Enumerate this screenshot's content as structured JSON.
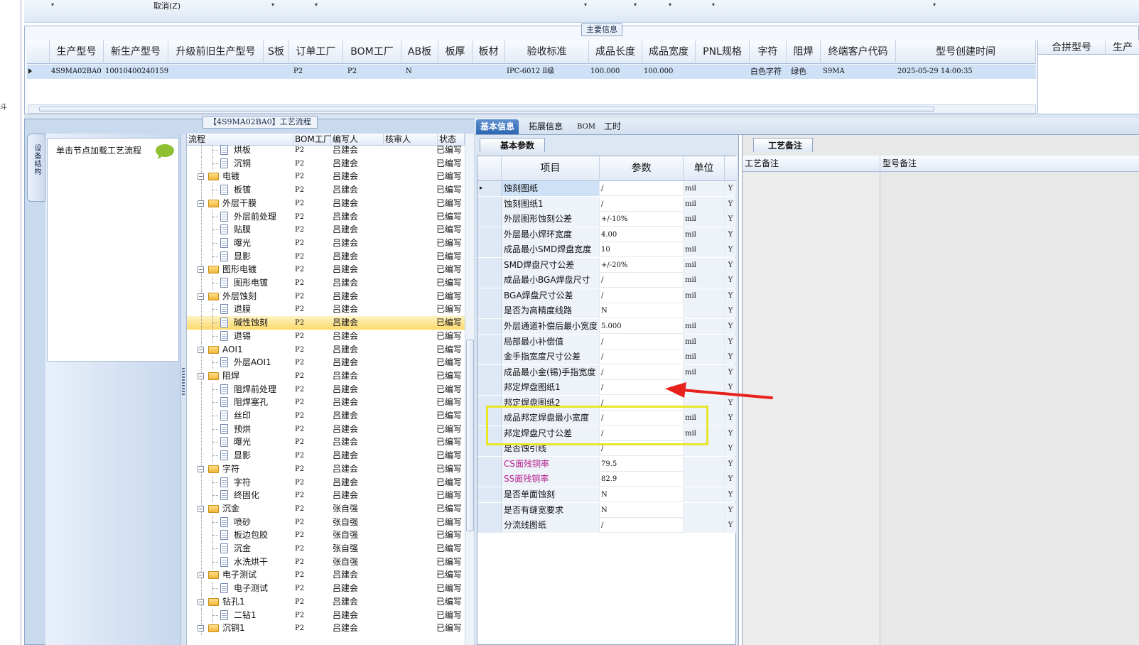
{
  "toolbar": {
    "cancel_label": "取消(Z)",
    "dropdown_glyph": "▾"
  },
  "left_strip": {
    "glyph": "斗"
  },
  "main_info": {
    "title": "主要信息",
    "columns": [
      "生产型号",
      "新生产型号",
      "升级前旧生产型号",
      "S板",
      "订单工厂",
      "BOM工厂",
      "AB板",
      "板厚",
      "板材",
      "验收标准",
      "成品长度",
      "成品宽度",
      "PNL规格",
      "字符",
      "阻焊",
      "终端客户代码",
      "型号创建时间"
    ],
    "row": {
      "production_model": "4S9MA02BA0",
      "new_model": "10010400240159",
      "old_model": "",
      "s_board": "",
      "order_factory": "P2",
      "bom_factory": "P2",
      "ab_board": "N",
      "thickness": "",
      "material": "",
      "standard": "IPC-6012 Ⅱ级",
      "length": "100.000",
      "width": "100.000",
      "pnl": "",
      "char": "白色字符",
      "solder": "绿色",
      "customer_code": "S9MA",
      "created": "2025-05-29 14:00:35"
    },
    "merge_columns": [
      "合拼型号",
      "生产"
    ]
  },
  "process": {
    "title": "【4S9MA02BA0】工艺流程",
    "side_tab": "设备结构",
    "hint": "单击节点加载工艺流程",
    "headers": [
      "流程",
      "BOM工厂",
      "编写人",
      "核审人",
      "状态"
    ],
    "rows": [
      {
        "name": "烘板",
        "level": 1,
        "factory": "P2",
        "writer": "吕建会",
        "status": "已编写"
      },
      {
        "name": "沉铜",
        "level": 1,
        "factory": "P2",
        "writer": "吕建会",
        "status": "已编写"
      },
      {
        "name": "电镀",
        "level": 0,
        "factory": "P2",
        "writer": "吕建会",
        "status": "已编写"
      },
      {
        "name": "板镀",
        "level": 1,
        "factory": "P2",
        "writer": "吕建会",
        "status": "已编写"
      },
      {
        "name": "外层干膜",
        "level": 0,
        "factory": "P2",
        "writer": "吕建会",
        "status": "已编写"
      },
      {
        "name": "外层前处理",
        "level": 1,
        "factory": "P2",
        "writer": "吕建会",
        "status": "已编写"
      },
      {
        "name": "贴膜",
        "level": 1,
        "factory": "P2",
        "writer": "吕建会",
        "status": "已编写"
      },
      {
        "name": "曝光",
        "level": 1,
        "factory": "P2",
        "writer": "吕建会",
        "status": "已编写"
      },
      {
        "name": "显影",
        "level": 1,
        "factory": "P2",
        "writer": "吕建会",
        "status": "已编写"
      },
      {
        "name": "图形电镀",
        "level": 0,
        "factory": "P2",
        "writer": "吕建会",
        "status": "已编写"
      },
      {
        "name": "图形电镀",
        "level": 1,
        "factory": "P2",
        "writer": "吕建会",
        "status": "已编写"
      },
      {
        "name": "外层蚀刻",
        "level": 0,
        "factory": "P2",
        "writer": "吕建会",
        "status": "已编写"
      },
      {
        "name": "退膜",
        "level": 1,
        "factory": "P2",
        "writer": "吕建会",
        "status": "已编写"
      },
      {
        "name": "碱性蚀刻",
        "level": 1,
        "factory": "P2",
        "writer": "吕建会",
        "status": "已编写",
        "selected": true
      },
      {
        "name": "退锡",
        "level": 1,
        "factory": "P2",
        "writer": "吕建会",
        "status": "已编写"
      },
      {
        "name": "AOI1",
        "level": 0,
        "factory": "P2",
        "writer": "吕建会",
        "status": "已编写"
      },
      {
        "name": "外层AOI1",
        "level": 1,
        "factory": "P2",
        "writer": "吕建会",
        "status": "已编写"
      },
      {
        "name": "阻焊",
        "level": 0,
        "factory": "P2",
        "writer": "吕建会",
        "status": "已编写"
      },
      {
        "name": "阻焊前处理",
        "level": 1,
        "factory": "P2",
        "writer": "吕建会",
        "status": "已编写"
      },
      {
        "name": "阻焊塞孔",
        "level": 1,
        "factory": "P2",
        "writer": "吕建会",
        "status": "已编写"
      },
      {
        "name": "丝印",
        "level": 1,
        "factory": "P2",
        "writer": "吕建会",
        "status": "已编写"
      },
      {
        "name": "预烘",
        "level": 1,
        "factory": "P2",
        "writer": "吕建会",
        "status": "已编写"
      },
      {
        "name": "曝光",
        "level": 1,
        "factory": "P2",
        "writer": "吕建会",
        "status": "已编写"
      },
      {
        "name": "显影",
        "level": 1,
        "factory": "P2",
        "writer": "吕建会",
        "status": "已编写"
      },
      {
        "name": "字符",
        "level": 0,
        "factory": "P2",
        "writer": "吕建会",
        "status": "已编写"
      },
      {
        "name": "字符",
        "level": 1,
        "factory": "P2",
        "writer": "吕建会",
        "status": "已编写"
      },
      {
        "name": "终固化",
        "level": 1,
        "factory": "P2",
        "writer": "吕建会",
        "status": "已编写"
      },
      {
        "name": "沉金",
        "level": 0,
        "factory": "P2",
        "writer": "张自强",
        "status": "已编写"
      },
      {
        "name": "喷砂",
        "level": 1,
        "factory": "P2",
        "writer": "张自强",
        "status": "已编写"
      },
      {
        "name": "板边包胶",
        "level": 1,
        "factory": "P2",
        "writer": "张自强",
        "status": "已编写"
      },
      {
        "name": "沉金",
        "level": 1,
        "factory": "P2",
        "writer": "张自强",
        "status": "已编写"
      },
      {
        "name": "水洗烘干",
        "level": 1,
        "factory": "P2",
        "writer": "张自强",
        "status": "已编写"
      },
      {
        "name": "电子测试",
        "level": 0,
        "factory": "P2",
        "writer": "吕建会",
        "status": "已编写"
      },
      {
        "name": "电子测试",
        "level": 1,
        "factory": "P2",
        "writer": "吕建会",
        "status": "已编写"
      },
      {
        "name": "钻孔1",
        "level": 0,
        "factory": "P2",
        "writer": "吕建会",
        "status": "已编写"
      },
      {
        "name": "二钻1",
        "level": 1,
        "factory": "P2",
        "writer": "吕建会",
        "status": "已编写"
      },
      {
        "name": "沉铜1",
        "level": 0,
        "factory": "P2",
        "writer": "吕建会",
        "status": "已编写"
      }
    ]
  },
  "tabs": [
    "基本信息",
    "拓展信息",
    "BOM",
    "工时"
  ],
  "basic": {
    "subtab": "基本参数",
    "headers": [
      "项目",
      "参数",
      "单位"
    ],
    "rows": [
      {
        "item": "蚀刻图纸",
        "value": "/",
        "unit": "mil",
        "flag": "Y"
      },
      {
        "item": "蚀刻图纸1",
        "value": "/",
        "unit": "mil",
        "flag": "Y"
      },
      {
        "item": "外层图形蚀刻公差",
        "value": "+/-10%",
        "unit": "mil",
        "flag": "Y"
      },
      {
        "item": "外层最小焊环宽度",
        "value": "4.00",
        "unit": "mil",
        "flag": "Y"
      },
      {
        "item": "成品最小SMD焊盘宽度",
        "value": "10",
        "unit": "mil",
        "flag": "Y"
      },
      {
        "item": "SMD焊盘尺寸公差",
        "value": "+/-20%",
        "unit": "mil",
        "flag": "Y"
      },
      {
        "item": "成品最小BGA焊盘尺寸",
        "value": "/",
        "unit": "mil",
        "flag": "Y"
      },
      {
        "item": "BGA焊盘尺寸公差",
        "value": "/",
        "unit": "mil",
        "flag": "Y"
      },
      {
        "item": "是否为高精度线路",
        "value": "N",
        "unit": "",
        "flag": "Y"
      },
      {
        "item": "外层通道补偿后最小宽度",
        "value": "5.000",
        "unit": "mil",
        "flag": "Y"
      },
      {
        "item": "局部最小补偿值",
        "value": "/",
        "unit": "mil",
        "flag": "Y"
      },
      {
        "item": "金手指宽度尺寸公差",
        "value": "/",
        "unit": "mil",
        "flag": "Y"
      },
      {
        "item": "成品最小金(锡)手指宽度",
        "value": "/",
        "unit": "mil",
        "flag": "Y"
      },
      {
        "item": "邦定焊盘图纸1",
        "value": "/",
        "unit": "",
        "flag": "Y"
      },
      {
        "item": "邦定焊盘图纸2",
        "value": "/",
        "unit": "",
        "flag": "Y"
      },
      {
        "item": "成品邦定焊盘最小宽度",
        "value": "/",
        "unit": "mil",
        "flag": "Y"
      },
      {
        "item": "邦定焊盘尺寸公差",
        "value": "/",
        "unit": "mil",
        "flag": "Y"
      },
      {
        "item": "是否蚀引线",
        "value": "/",
        "unit": "",
        "flag": "Y"
      },
      {
        "item": "CS面残铜率",
        "value": "79.5",
        "unit": "",
        "flag": "Y",
        "pink": true
      },
      {
        "item": "SS面残铜率",
        "value": "82.9",
        "unit": "",
        "flag": "Y",
        "pink": true
      },
      {
        "item": "是否单面蚀刻",
        "value": "N",
        "unit": "",
        "flag": "Y"
      },
      {
        "item": "是否有缝宽要求",
        "value": "N",
        "unit": "",
        "flag": "Y"
      },
      {
        "item": "分流线图纸",
        "value": "/",
        "unit": "",
        "flag": "Y"
      }
    ]
  },
  "remarks": {
    "tab": "工艺备注",
    "headers": [
      "工艺备注",
      "型号备注"
    ]
  },
  "colors": {
    "selection": "#cfe1f7",
    "tree_selected": "#fcd96a",
    "annotation_yellow": "#e9e62a",
    "annotation_arrow": "#e8211c",
    "pink_text": "#b5208a"
  }
}
